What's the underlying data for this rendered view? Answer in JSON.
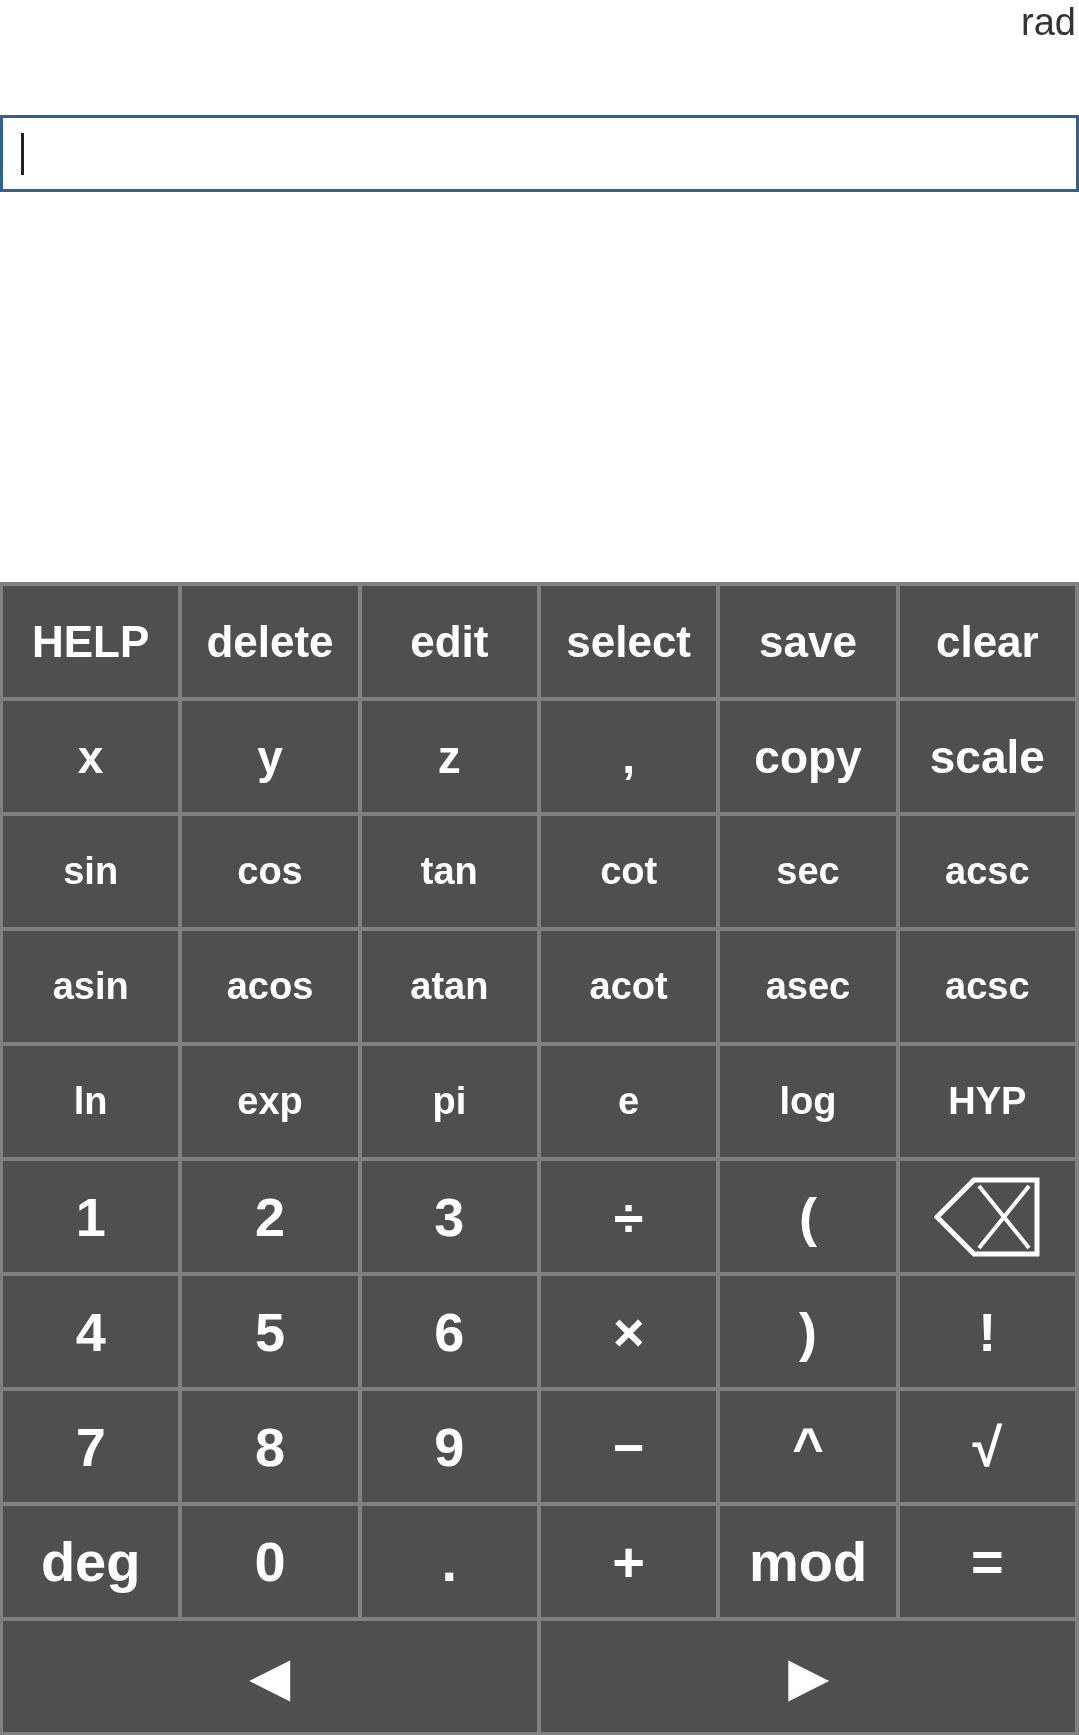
{
  "angle_mode": "rad",
  "input": {
    "focused": true
  },
  "keypad": {
    "rows": [
      [
        {
          "kind": "text",
          "label": "HELP"
        },
        {
          "kind": "text",
          "label": "delete"
        },
        {
          "kind": "text",
          "label": "edit"
        },
        {
          "kind": "text",
          "label": "select"
        },
        {
          "kind": "text",
          "label": "save"
        },
        {
          "kind": "text",
          "label": "clear"
        }
      ],
      [
        {
          "kind": "text",
          "label": "x"
        },
        {
          "kind": "text",
          "label": "y"
        },
        {
          "kind": "text",
          "label": "z"
        },
        {
          "kind": "text",
          "label": ","
        },
        {
          "kind": "text",
          "label": "copy"
        },
        {
          "kind": "text",
          "label": "scale"
        }
      ],
      [
        {
          "kind": "text",
          "label": "sin"
        },
        {
          "kind": "text",
          "label": "cos"
        },
        {
          "kind": "text",
          "label": "tan"
        },
        {
          "kind": "text",
          "label": "cot"
        },
        {
          "kind": "text",
          "label": "sec"
        },
        {
          "kind": "text",
          "label": "acsc"
        }
      ],
      [
        {
          "kind": "text",
          "label": "asin"
        },
        {
          "kind": "text",
          "label": "acos"
        },
        {
          "kind": "text",
          "label": "atan"
        },
        {
          "kind": "text",
          "label": "acot"
        },
        {
          "kind": "text",
          "label": "asec"
        },
        {
          "kind": "text",
          "label": "acsc"
        }
      ],
      [
        {
          "kind": "text",
          "label": "ln"
        },
        {
          "kind": "text",
          "label": "exp"
        },
        {
          "kind": "text",
          "label": "pi"
        },
        {
          "kind": "text",
          "label": "e"
        },
        {
          "kind": "text",
          "label": "log"
        },
        {
          "kind": "text",
          "label": "HYP"
        }
      ],
      [
        {
          "kind": "text",
          "label": "1"
        },
        {
          "kind": "text",
          "label": "2"
        },
        {
          "kind": "text",
          "label": "3"
        },
        {
          "kind": "text",
          "label": "÷"
        },
        {
          "kind": "text",
          "label": "("
        },
        {
          "kind": "backspace"
        }
      ],
      [
        {
          "kind": "text",
          "label": "4"
        },
        {
          "kind": "text",
          "label": "5"
        },
        {
          "kind": "text",
          "label": "6"
        },
        {
          "kind": "text",
          "label": "×"
        },
        {
          "kind": "text",
          "label": ")"
        },
        {
          "kind": "text",
          "label": "!"
        }
      ],
      [
        {
          "kind": "text",
          "label": "7"
        },
        {
          "kind": "text",
          "label": "8"
        },
        {
          "kind": "text",
          "label": "9"
        },
        {
          "kind": "text",
          "label": "−"
        },
        {
          "kind": "text",
          "label": "^"
        },
        {
          "kind": "text",
          "label": "√"
        }
      ],
      [
        {
          "kind": "text",
          "label": "deg"
        },
        {
          "kind": "text",
          "label": "0"
        },
        {
          "kind": "text",
          "label": "."
        },
        {
          "kind": "text",
          "label": "+"
        },
        {
          "kind": "text",
          "label": "mod"
        },
        {
          "kind": "text",
          "label": "="
        }
      ]
    ],
    "cursor_keys": [
      {
        "label": "◀"
      },
      {
        "label": "▶"
      }
    ]
  }
}
